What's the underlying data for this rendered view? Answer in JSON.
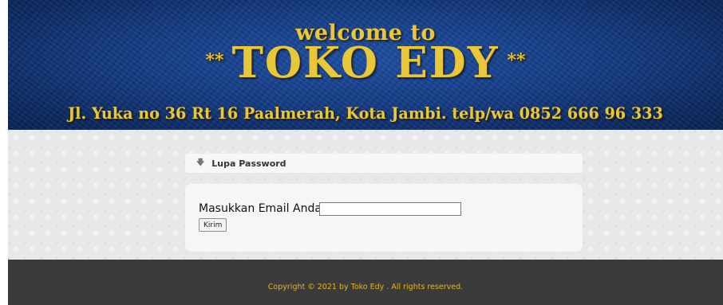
{
  "header": {
    "welcome": "welcome to",
    "stars": "**",
    "store_name": "TOKO EDY",
    "address": "Jl. Yuka no 36 Rt 16 Paalmerah, Kota Jambi. telp/wa 0852 666 96 333"
  },
  "panel": {
    "title": "Lupa Password",
    "title_icon": "down-arrow-icon",
    "email_label": "Masukkan Email Anda :",
    "email_value": "",
    "send_button": "Kirim"
  },
  "footer": {
    "copyright": "Copyright © 2021 by Toko Edy . All rights reserved."
  },
  "colors": {
    "banner_blue": "#153d86",
    "gold": "#e8c73a",
    "footer_bg": "#3b3b3b",
    "footer_text": "#e0b62a"
  }
}
